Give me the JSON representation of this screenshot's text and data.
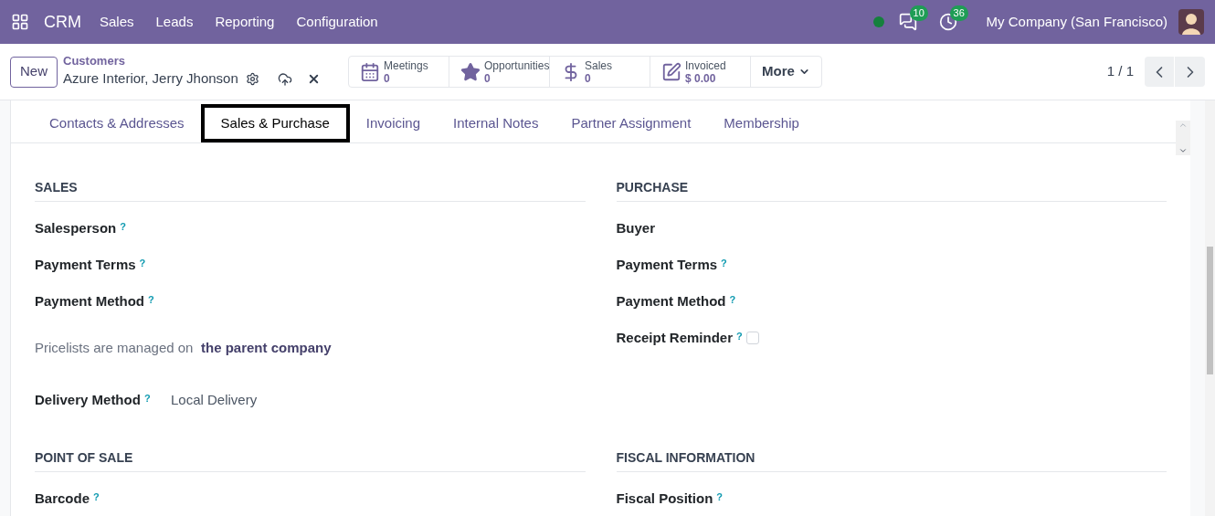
{
  "navbar": {
    "app": "CRM",
    "menu": [
      "Sales",
      "Leads",
      "Reporting",
      "Configuration"
    ],
    "online": true,
    "messages_count": "10",
    "activities_count": "36",
    "company": "My Company (San Francisco)"
  },
  "control_panel": {
    "new_button": "New",
    "breadcrumb": "Customers",
    "record": "Azure Interior, Jerry Jhonson",
    "pager": "1 / 1",
    "stats": [
      {
        "kind": "calendar",
        "label": "Meetings",
        "value": "0"
      },
      {
        "kind": "star",
        "label": "Opportunities",
        "value": "0"
      },
      {
        "kind": "dollar",
        "label": "Sales",
        "value": "0"
      },
      {
        "kind": "edit",
        "label": "Invoiced",
        "value": "$ 0.00"
      }
    ],
    "more_button": "More"
  },
  "tabs": [
    {
      "label": "Contacts & Addresses",
      "selected": false
    },
    {
      "label": "Sales & Purchase",
      "selected": true
    },
    {
      "label": "Invoicing",
      "selected": false
    },
    {
      "label": "Internal Notes",
      "selected": false
    },
    {
      "label": "Partner Assignment",
      "selected": false
    },
    {
      "label": "Membership",
      "selected": false
    }
  ],
  "sections": [
    {
      "left": {
        "title": "SALES",
        "fields": [
          {
            "kind": "field",
            "label": "Salesperson",
            "help": "?"
          },
          {
            "kind": "field",
            "label": "Payment Terms",
            "help": "?"
          },
          {
            "kind": "field",
            "label": "Payment Method",
            "help": "?"
          },
          {
            "kind": "note",
            "text": "Pricelists are managed on",
            "link": "the parent company"
          },
          {
            "kind": "field",
            "label": "Delivery Method",
            "help": "?",
            "value": "Local Delivery"
          }
        ]
      },
      "right": {
        "title": "PURCHASE",
        "fields": [
          {
            "kind": "field",
            "label": "Buyer"
          },
          {
            "kind": "field",
            "label": "Payment Terms",
            "help": "?"
          },
          {
            "kind": "field",
            "label": "Payment Method",
            "help": "?"
          },
          {
            "kind": "checkbox",
            "label": "Receipt Reminder",
            "help": "?",
            "checked": false
          }
        ]
      }
    },
    {
      "left": {
        "title": "POINT OF SALE",
        "fields": [
          {
            "kind": "field",
            "label": "Barcode",
            "help": "?"
          }
        ]
      },
      "right": {
        "title": "FISCAL INFORMATION",
        "fields": [
          {
            "kind": "field",
            "label": "Fiscal Position",
            "help": "?"
          }
        ]
      }
    }
  ]
}
